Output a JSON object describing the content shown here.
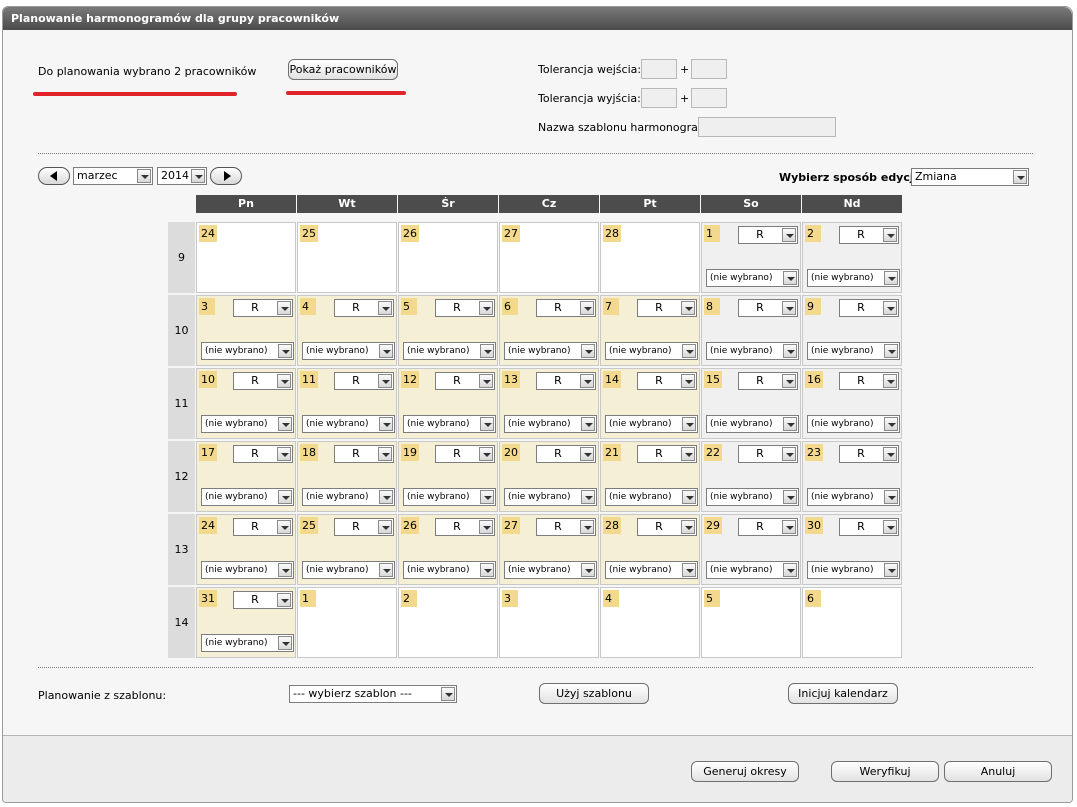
{
  "window": {
    "title": "Planowanie harmonogramów dla grupy pracowników"
  },
  "header": {
    "selected_text": "Do planowania wybrano 2 pracowników",
    "show_button": "Pokaż pracowników",
    "entry_tolerance_label": "Tolerancja wejścia: -",
    "exit_tolerance_label": "Tolerancja wyjścia: -",
    "plus": "+",
    "template_name_label": "Nazwa szablonu harmonogramu:"
  },
  "nav": {
    "month": "marzec",
    "year": "2014",
    "edit_mode_label": "Wybierz sposób edycji:",
    "edit_mode_value": "Zmiana"
  },
  "calendar": {
    "days": [
      "Pn",
      "Wt",
      "Śr",
      "Cz",
      "Pt",
      "So",
      "Nd"
    ],
    "shift_default": "R",
    "employee_default": "(nie wybrano)",
    "weeks": [
      {
        "week": "9",
        "cells": [
          "24",
          "25",
          "26",
          "27",
          "28",
          "1",
          "2"
        ]
      },
      {
        "week": "10",
        "cells": [
          "3",
          "4",
          "5",
          "6",
          "7",
          "8",
          "9"
        ]
      },
      {
        "week": "11",
        "cells": [
          "10",
          "11",
          "12",
          "13",
          "14",
          "15",
          "16"
        ]
      },
      {
        "week": "12",
        "cells": [
          "17",
          "18",
          "19",
          "20",
          "21",
          "22",
          "23"
        ]
      },
      {
        "week": "13",
        "cells": [
          "24",
          "25",
          "26",
          "27",
          "28",
          "29",
          "30"
        ]
      },
      {
        "week": "14",
        "cells": [
          "31",
          "1",
          "2",
          "3",
          "4",
          "5",
          "6"
        ]
      }
    ]
  },
  "template": {
    "label": "Planowanie z szablonu:",
    "select_value": "--- wybierz szablon ---",
    "use_button": "Użyj szablonu",
    "init_button": "Inicjuj kalendarz"
  },
  "footer": {
    "generate_button": "Generuj okresy",
    "verify_button": "Weryfikuj",
    "cancel_button": "Anuluj"
  },
  "colors": {
    "titlebar": "#4a4a4a",
    "day_number": "#f3d98d",
    "current_month_cell": "#f5efd6",
    "weekend_cell": "#f0f0f0",
    "highlight_line": "#e0242a"
  }
}
